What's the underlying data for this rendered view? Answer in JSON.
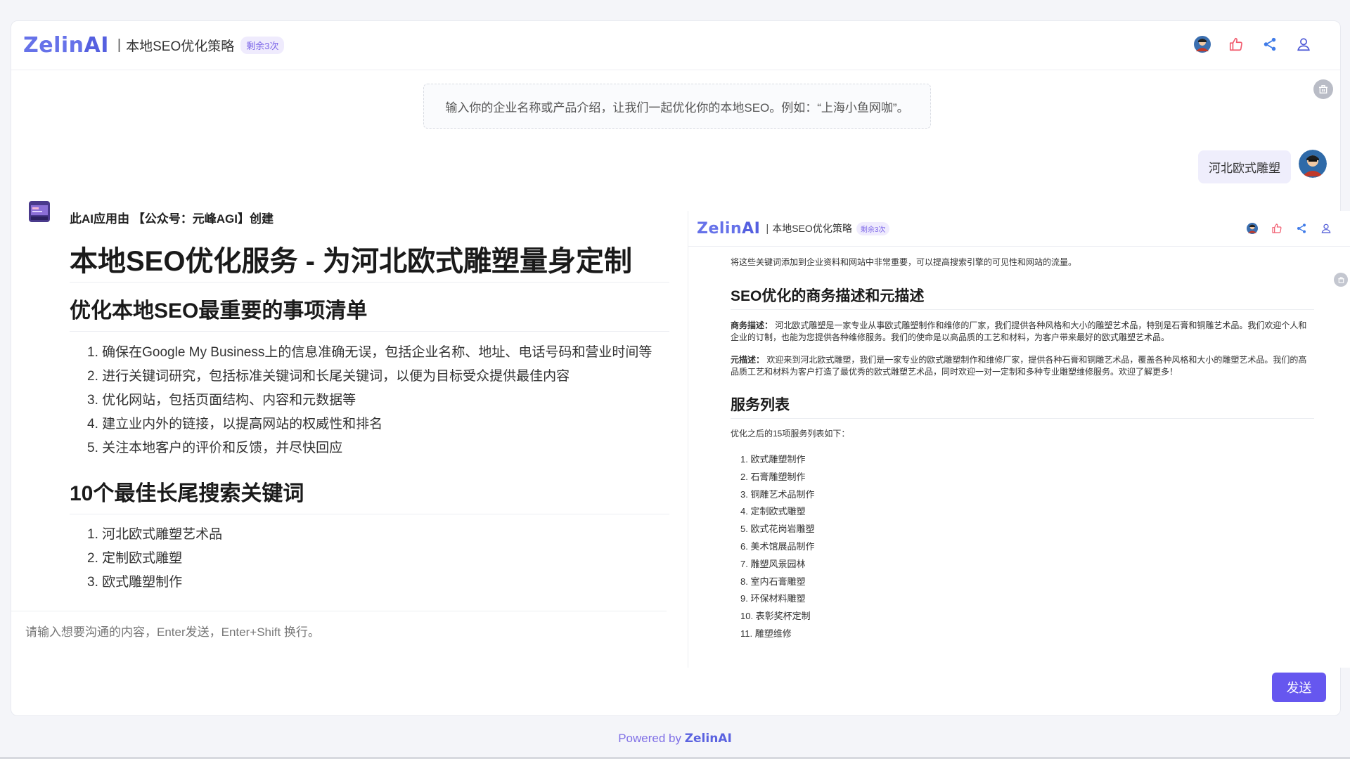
{
  "header": {
    "logo_main": "Zelin",
    "logo_ai": "AI",
    "separator": "|",
    "title": "本地SEO优化策略",
    "quota": "剩余3次",
    "icons": [
      "avatar",
      "thumbs-up-icon",
      "share-icon",
      "user-icon"
    ]
  },
  "intro": {
    "text": "输入你的企业名称或产品介绍，让我们一起优化你的本地SEO。例如：“上海小鱼网咖”。"
  },
  "user_message": {
    "text": "河北欧式雕塑"
  },
  "bot_message": {
    "creator": "此AI应用由 【公众号：元峰AGI】创建",
    "title": "本地SEO优化服务 - 为河北欧式雕塑量身定制",
    "section1_title": "优化本地SEO最重要的事项清单",
    "section1_items": [
      "1. 确保在Google My Business上的信息准确无误，包括企业名称、地址、电话号码和营业时间等",
      "2. 进行关键词研究，包括标准关键词和长尾关键词，以便为目标受众提供最佳内容",
      "3. 优化网站，包括页面结构、内容和元数据等",
      "4. 建立业内外的链接，以提高网站的权威性和排名",
      "5. 关注本地客户的评价和反馈，并尽快回应"
    ],
    "section2_title": "10个最佳长尾搜索关键词",
    "section2_items": [
      "1. 河北欧式雕塑艺术品",
      "2. 定制欧式雕塑",
      "3. 欧式雕塑制作"
    ]
  },
  "screenshot": {
    "header_title": "本地SEO优化策略",
    "header_quota": "剩余3次",
    "top_text": "将这些关键词添加到企业资料和网站中非常重要，可以提高搜索引擎的可见性和网站的流量。",
    "section_desc_title": "SEO优化的商务描述和元描述",
    "business_label": "商务描述：",
    "business_text": "河北欧式雕塑是一家专业从事欧式雕塑制作和维修的厂家，我们提供各种风格和大小的雕塑艺术品，特别是石膏和铜雕艺术品。我们欢迎个人和企业的订制，也能为您提供各种维修服务。我们的使命是以高品质的工艺和材料，为客户带来最好的欧式雕塑艺术品。",
    "meta_label": "元描述：",
    "meta_text": "欢迎来到河北欧式雕塑，我们是一家专业的欧式雕塑制作和维修厂家，提供各种石膏和铜雕艺术品，覆盖各种风格和大小的雕塑艺术品。我们的高品质工艺和材料为客户打造了最优秀的欧式雕塑艺术品，同时欢迎一对一定制和多种专业雕塑维修服务。欢迎了解更多！",
    "services_title": "服务列表",
    "services_intro": "优化之后的15项服务列表如下：",
    "services": [
      "1. 欧式雕塑制作",
      "2. 石膏雕塑制作",
      "3. 铜雕艺术品制作",
      "4. 定制欧式雕塑",
      "5. 欧式花岗岩雕塑",
      "6. 美术馆展品制作",
      "7. 雕塑风景园林",
      "8. 室内石膏雕塑",
      "9. 环保材料雕塑",
      "10. 表彰奖杯定制",
      "11. 雕塑维修"
    ]
  },
  "input": {
    "placeholder": "请输入想要沟通的内容，Enter发送，Enter+Shift 换行。",
    "send_label": "发送"
  },
  "footer": {
    "powered": "Powered by ",
    "brand": "ZelinAI"
  },
  "colors": {
    "accent": "#6657ef",
    "logo": "#6672e9",
    "quota_bg": "#efebfd",
    "user_bubble": "#efeefc"
  }
}
